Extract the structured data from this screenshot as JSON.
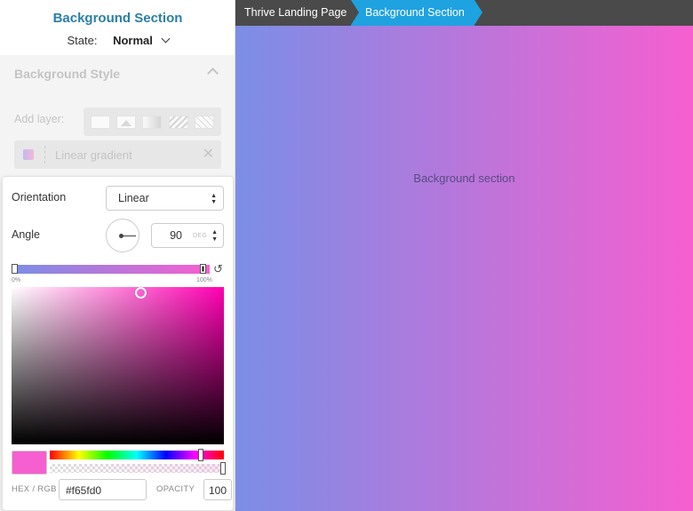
{
  "sidebar": {
    "title": "Background Section",
    "state_label": "State:",
    "state_value": "Normal",
    "bg_style_heading": "Background Style",
    "add_layer_label": "Add layer:",
    "layer_name": "Linear gradient"
  },
  "popup": {
    "orientation_label": "Orientation",
    "orientation_value": "Linear",
    "angle_label": "Angle",
    "angle_value": "90",
    "angle_unit": "DEG",
    "stop_start_pct": "0%",
    "stop_end_pct": "100%",
    "hex_label": "HEX / RGB",
    "hex_value": "#f65fd0",
    "opacity_label": "OPACITY",
    "opacity_value": "100",
    "gradient_start_color": "#7b8ee6",
    "gradient_end_color": "#f65fd0"
  },
  "canvas": {
    "breadcrumb": [
      "Thrive Landing Page",
      "Background Section"
    ],
    "section_text": "Background section",
    "breadcrumb_active_color": "#1fa2e0"
  }
}
